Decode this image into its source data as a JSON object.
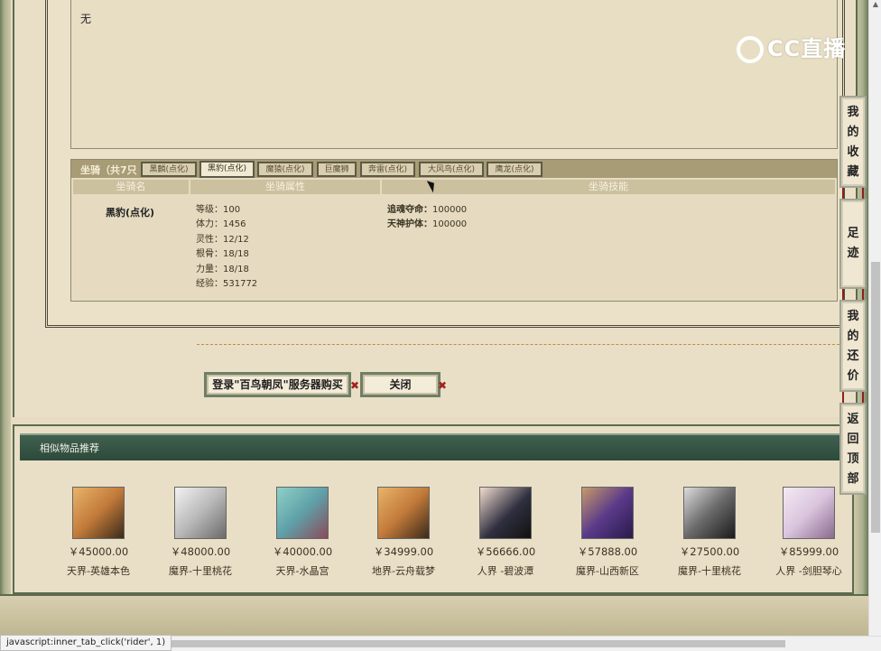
{
  "description": {
    "text": "无"
  },
  "watermark": {
    "text": "CC直播"
  },
  "mount": {
    "section_title": "坐骑（共7只",
    "tabs": [
      "黑麟(点化)",
      "黑豹(点化)",
      "魔猿(点化)",
      "巨魔狮",
      "奔雷(点化)",
      "大风鸟(点化)",
      "鹰龙(点化)"
    ],
    "active_tab": "黑豹(点化)",
    "columns": [
      "坐骑名",
      "坐骑属性",
      "坐骑技能"
    ],
    "name": "黑豹(点化)",
    "attributes": [
      "等级：100",
      "体力：1456",
      "灵性：12/12",
      "根骨：18/18",
      "力量：18/18",
      "经验：531772"
    ],
    "skills": [
      {
        "name": "追魂夺命：",
        "value": "100000"
      },
      {
        "name": "天神护体：",
        "value": "100000"
      }
    ]
  },
  "buttons": {
    "login_buy": "登录\"百鸟朝凤\"服务器购买",
    "close": "关闭"
  },
  "recommend": {
    "title": "相似物品推荐",
    "items": [
      {
        "price": "￥45000.00",
        "server": "天界-英雄本色",
        "color": "#c27a3a"
      },
      {
        "price": "￥48000.00",
        "server": "魔界-十里桃花",
        "color": "#b9b9b9"
      },
      {
        "price": "￥40000.00",
        "server": "天界-水晶宫",
        "color": "#5fa0a8"
      },
      {
        "price": "￥34999.00",
        "server": "地界-云舟载梦",
        "color": "#c27a3a"
      },
      {
        "price": "￥56666.00",
        "server": "人界 -碧波潭",
        "color": "#2f2f3f"
      },
      {
        "price": "￥57888.00",
        "server": "魔界-山西新区",
        "color": "#5a3a8a"
      },
      {
        "price": "￥27500.00",
        "server": "魔界-十里桃花",
        "color": "#6a6a6a"
      },
      {
        "price": "￥85999.00",
        "server": "人界 -剑胆琴心",
        "color": "#d9c4dc"
      }
    ]
  },
  "side_nav": [
    "我的收藏",
    "足迹",
    "我的还价",
    "返回顶部"
  ],
  "status_bar": {
    "text": "javascript:inner_tab_click('rider', 1)"
  }
}
